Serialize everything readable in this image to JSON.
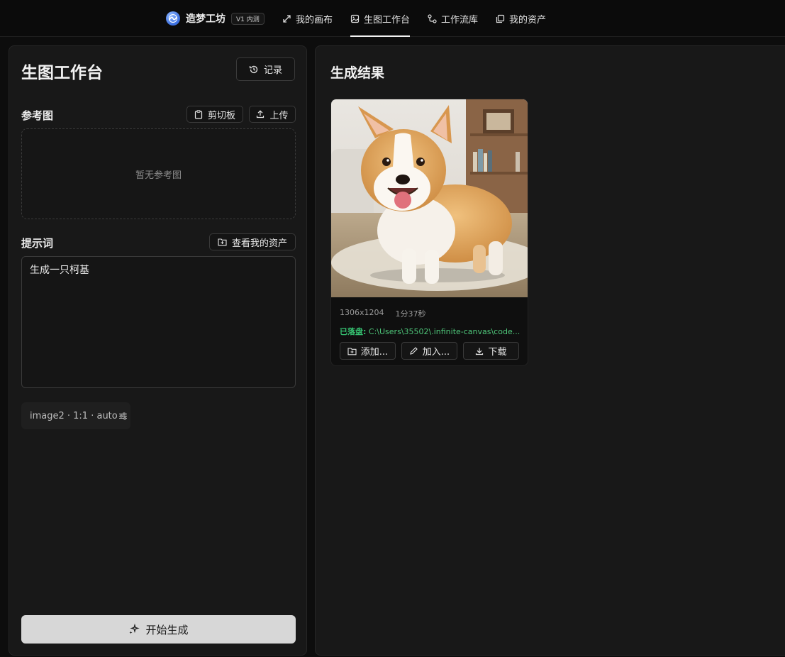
{
  "header": {
    "brand_name": "造梦工坊",
    "brand_badge": "V1 内测",
    "nav": [
      {
        "label": "我的画布",
        "icon": "expand-icon"
      },
      {
        "label": "生图工作台",
        "icon": "image-icon",
        "active": true
      },
      {
        "label": "工作流库",
        "icon": "workflow-icon"
      },
      {
        "label": "我的资产",
        "icon": "assets-icon"
      }
    ]
  },
  "workbench": {
    "title": "生图工作台",
    "history_label": "记录",
    "reference": {
      "title": "参考图",
      "clipboard_label": "剪切板",
      "upload_label": "上传",
      "empty_text": "暂无参考图"
    },
    "prompt": {
      "title": "提示词",
      "assets_label": "查看我的资产",
      "value": "生成一只柯基"
    },
    "params_text": "image2 · 1:1 · auto",
    "generate_label": "开始生成"
  },
  "results": {
    "title": "生成结果",
    "card": {
      "image_subject": "corgi",
      "dimensions": "1306x1204",
      "duration": "1分37秒",
      "saved_label": "已落盘:",
      "saved_path": "C:\\Users\\35502\\.infinite-canvas\\code...",
      "actions": [
        "添加...",
        "加入...",
        "下载"
      ]
    }
  },
  "colors": {
    "background": "#0d0d0d",
    "panel": "#181818",
    "accent_green": "#4fc77a",
    "generate_button": "#d7d7d7"
  }
}
